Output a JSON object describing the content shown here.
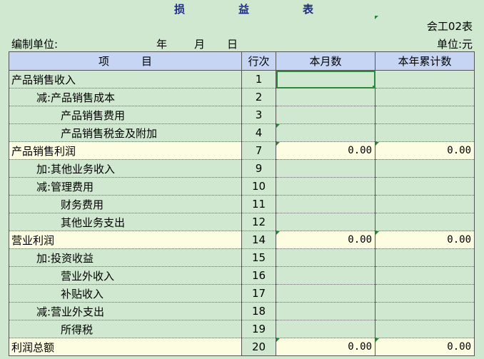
{
  "header": {
    "title_chars": [
      "损",
      "益",
      "表"
    ],
    "form_code": "会工02表",
    "unit_label": "编制单位:",
    "year_label": "年",
    "month_label": "月",
    "day_label": "日",
    "currency_label": "单位:元"
  },
  "table": {
    "columns": [
      "项　　　目",
      "行次",
      "本月数",
      "本年累计数"
    ],
    "rows": [
      {
        "item": "产品销售收入",
        "level": 0,
        "line": "1",
        "month": "",
        "ytd": ""
      },
      {
        "item": "减:产品销售成本",
        "level": 1,
        "line": "2",
        "month": "",
        "ytd": ""
      },
      {
        "item": "产品销售费用",
        "level": 2,
        "line": "3",
        "month": "",
        "ytd": ""
      },
      {
        "item": "产品销售税金及附加",
        "level": 2,
        "line": "4",
        "month": "",
        "ytd": ""
      },
      {
        "item": "产品销售利润",
        "level": 0,
        "line": "7",
        "month": "0.00",
        "ytd": "0.00",
        "highlight": true
      },
      {
        "item": "加:其他业务收入",
        "level": 1,
        "line": "9",
        "month": "",
        "ytd": ""
      },
      {
        "item": "减:管理费用",
        "level": 1,
        "line": "10",
        "month": "",
        "ytd": ""
      },
      {
        "item": "财务费用",
        "level": 2,
        "line": "11",
        "month": "",
        "ytd": ""
      },
      {
        "item": "其他业务支出",
        "level": 2,
        "line": "12",
        "month": "",
        "ytd": ""
      },
      {
        "item": "营业利润",
        "level": 0,
        "line": "14",
        "month": "0.00",
        "ytd": "0.00",
        "highlight": true
      },
      {
        "item": "加:投资收益",
        "level": 1,
        "line": "15",
        "month": "",
        "ytd": ""
      },
      {
        "item": "营业外收入",
        "level": 2,
        "line": "16",
        "month": "",
        "ytd": ""
      },
      {
        "item": "补贴收入",
        "level": 2,
        "line": "17",
        "month": "",
        "ytd": ""
      },
      {
        "item": "减:营业外支出",
        "level": 1,
        "line": "18",
        "month": "",
        "ytd": ""
      },
      {
        "item": "所得税",
        "level": 2,
        "line": "19",
        "month": "",
        "ytd": ""
      },
      {
        "item": "利润总额",
        "level": 0,
        "line": "20",
        "month": "0.00",
        "ytd": "0.00",
        "highlight": true
      }
    ]
  }
}
